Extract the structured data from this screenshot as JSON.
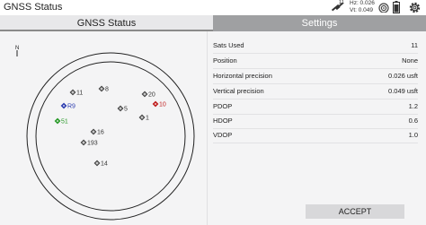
{
  "app": {
    "title": "GNSS Status"
  },
  "status": {
    "sat_count": "11",
    "hz": "Hz: 0.026",
    "vt": "Vt: 0.049"
  },
  "tabs": [
    {
      "label": "GNSS Status",
      "active": true
    },
    {
      "label": "Settings",
      "active": false
    }
  ],
  "skyplot": {
    "north_label": "N",
    "satellites": [
      {
        "id": "11",
        "color": "#333333"
      },
      {
        "id": "8",
        "color": "#333333"
      },
      {
        "id": "20",
        "color": "#333333"
      },
      {
        "id": "R9",
        "color": "#3040b0"
      },
      {
        "id": "5",
        "color": "#333333"
      },
      {
        "id": "10",
        "color": "#c02020"
      },
      {
        "id": "1",
        "color": "#333333"
      },
      {
        "id": "51",
        "color": "#2a9a2a"
      },
      {
        "id": "16",
        "color": "#333333"
      },
      {
        "id": "193",
        "color": "#333333"
      },
      {
        "id": "14",
        "color": "#333333"
      }
    ]
  },
  "info": {
    "rows": [
      {
        "label": "Sats Used",
        "value": "11"
      },
      {
        "label": "Position",
        "value": "None"
      },
      {
        "label": "Horizontal precision",
        "value": "0.026 usft"
      },
      {
        "label": "Vertical precision",
        "value": "0.049 usft"
      },
      {
        "label": "PDOP",
        "value": "1.2"
      },
      {
        "label": "HDOP",
        "value": "0.6"
      },
      {
        "label": "VDOP",
        "value": "1.0"
      }
    ],
    "accept_label": "ACCEPT"
  },
  "icons": {
    "satellite": "satellite-icon",
    "wifi": "wifi-icon",
    "battery": "battery-icon",
    "settings": "gear-icon"
  }
}
